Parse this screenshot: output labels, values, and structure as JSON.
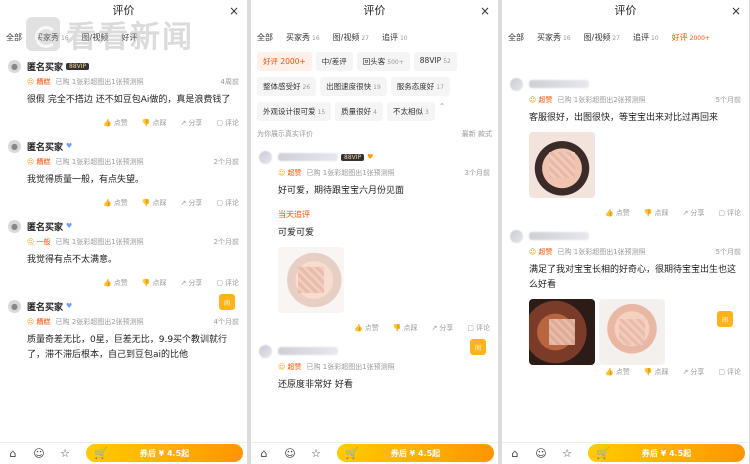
{
  "watermark": {
    "text": "看看新闻",
    "sub": ""
  },
  "panel1": {
    "title": "评价",
    "close": "×",
    "tabs": [
      {
        "label": "全部",
        "count": ""
      },
      {
        "label": "买家秀",
        "count": "16"
      },
      {
        "label": "图/视频",
        "count": ""
      },
      {
        "label": "好评",
        "count": ""
      }
    ],
    "reviews": [
      {
        "name": "匿名买家",
        "vip": "88VIP",
        "rating": "糟糕",
        "meta": "已购 1张彩超图出1张预测照",
        "date": "4周前",
        "text": "很假 完全不搭边 还不如豆包Ai做的，真是浪费钱了"
      },
      {
        "name": "匿名买家",
        "vip": "",
        "rating": "糟糕",
        "meta": "已购 1张彩超图出1张预测照",
        "date": "2个月前",
        "text": "我觉得质量一般，有点失望。"
      },
      {
        "name": "匿名买家",
        "vip": "",
        "rating": "一般",
        "meta": "已购 1张彩超图出1张预测照",
        "date": "2个月前",
        "text": "我觉得有点不太满意。"
      },
      {
        "name": "匿名买家",
        "vip": "",
        "rating": "糟糕",
        "meta": "已购 2张彩超图出2张预测照",
        "date": "4个月前",
        "text": "质量奇差无比，0星，巨差无比，9.9买个教训就行了，滞不滞后根本，自己到豆包ai的比他"
      }
    ],
    "actions": [
      "点赞",
      "点踩",
      "分享",
      "评论"
    ]
  },
  "panel2": {
    "title": "评价",
    "close": "×",
    "tabs": [
      {
        "label": "全部",
        "count": ""
      },
      {
        "label": "买家秀",
        "count": "16"
      },
      {
        "label": "图/视频",
        "count": "27"
      },
      {
        "label": "追评",
        "count": "10"
      }
    ],
    "chips_row1": [
      {
        "label": "好评 2000+",
        "count": "",
        "active": true
      },
      {
        "label": "中/差评",
        "count": "",
        "active": false
      },
      {
        "label": "回头客",
        "count": "500+",
        "active": false
      },
      {
        "label": "88VIP",
        "count": "52",
        "active": false
      }
    ],
    "chips_row2": [
      {
        "label": "整体感受好",
        "count": "26"
      },
      {
        "label": "出图速度很快",
        "count": "19"
      },
      {
        "label": "服务态度好",
        "count": "17"
      }
    ],
    "chips_row3": [
      {
        "label": "外观设计很可爱",
        "count": "15"
      },
      {
        "label": "质量很好",
        "count": "4"
      },
      {
        "label": "不太相似",
        "count": "3"
      }
    ],
    "subbar_left": "为你展示真实评价",
    "subbar_right": "最新  款式",
    "reviews": [
      {
        "vip": "88VIP",
        "rating": "超赞",
        "meta": "已购 1张彩超图出1张预测照",
        "date": "3个月前",
        "text": "好可爱，期待跟宝宝六月份见面",
        "followup_label": "当天追评",
        "followup_text": "可爱可爱"
      },
      {
        "rating": "超赞",
        "meta": "已购 1张彩超图出1张预测照",
        "date": "",
        "text": "还原度非常好 好看"
      }
    ],
    "actions": [
      "点赞",
      "点踩",
      "分享",
      "评论"
    ]
  },
  "panel3": {
    "title": "评价",
    "close": "×",
    "tabs": [
      {
        "label": "全部",
        "count": ""
      },
      {
        "label": "买家秀",
        "count": "16"
      },
      {
        "label": "图/视频",
        "count": "27"
      },
      {
        "label": "追评",
        "count": "10"
      },
      {
        "label": "好评",
        "count": "2000+"
      }
    ],
    "reviews": [
      {
        "rating": "超赞",
        "meta": "已购 1张彩超图出2张预测照",
        "date": "5个月前",
        "text": "客服很好，出图很快，等宝宝出来对比过再回来"
      },
      {
        "rating": "超赞",
        "meta": "已购 1张彩超图出1张预测照",
        "date": "5个月前",
        "text": "满足了我对宝宝长相的好奇心，很期待宝宝出生也这么好看"
      }
    ],
    "actions": [
      "点赞",
      "点踩",
      "分享",
      "评论"
    ]
  },
  "bottom": {
    "buy_label": "券后 ¥ 4.5起",
    "cart_badge": "间"
  }
}
